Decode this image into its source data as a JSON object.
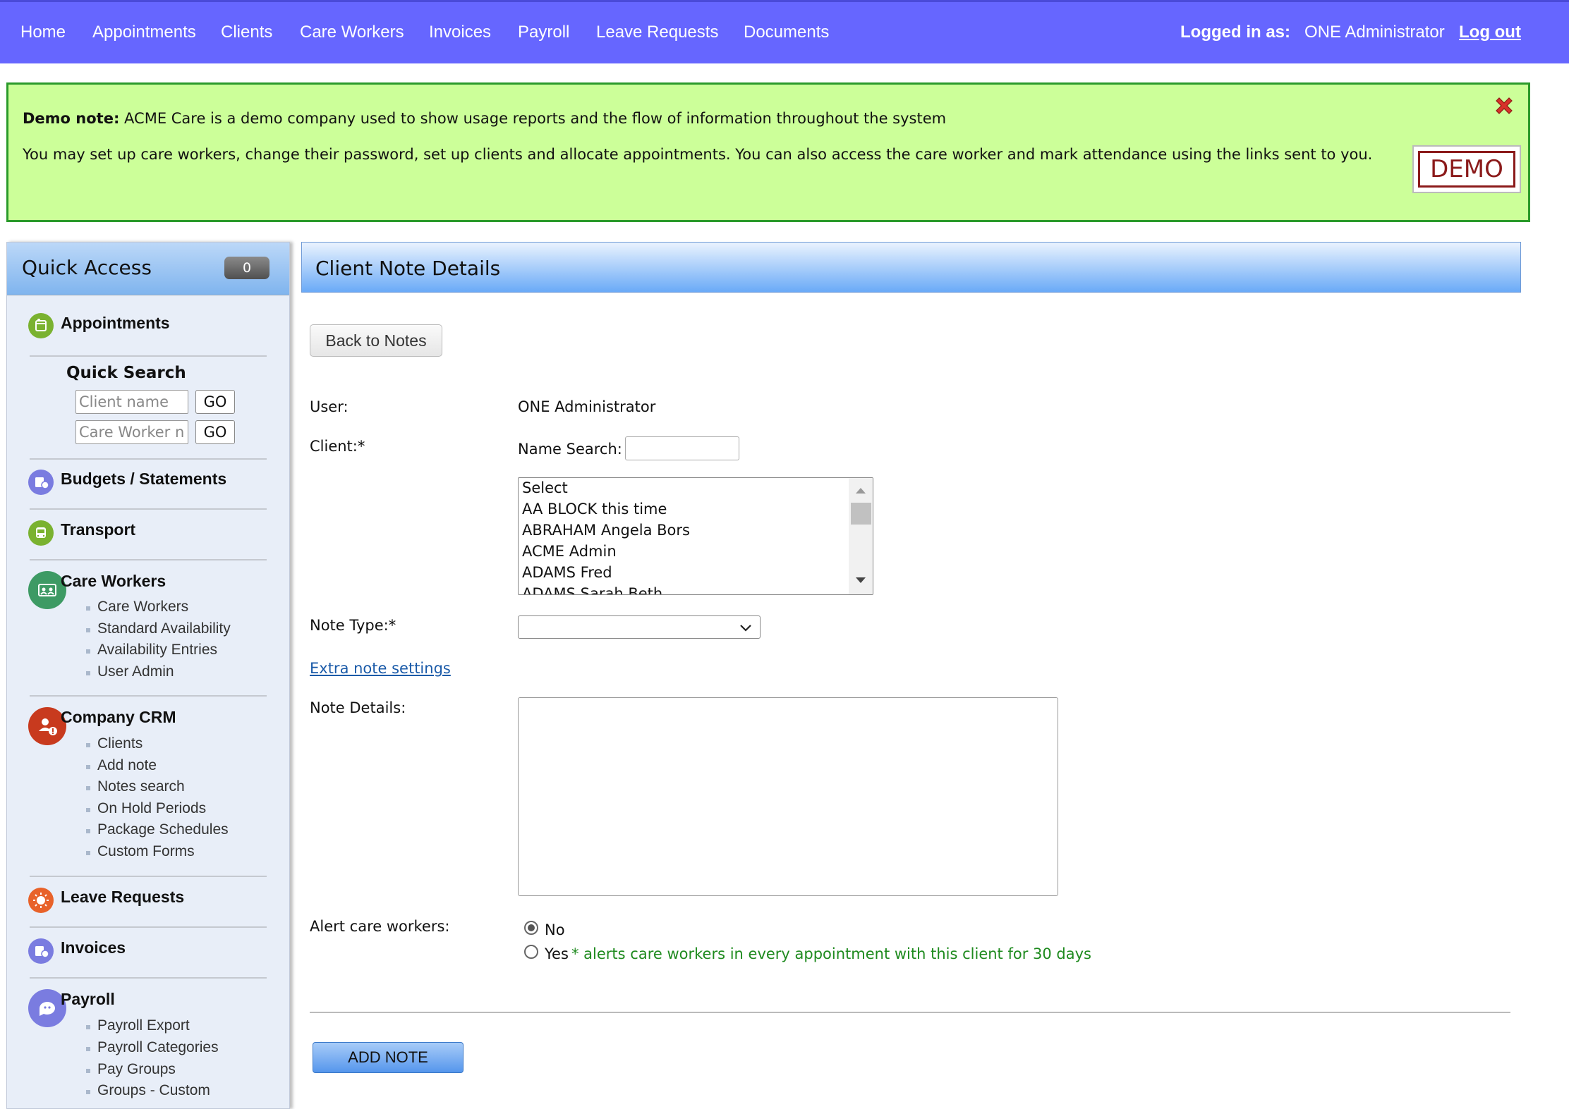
{
  "nav": {
    "items": [
      "Home",
      "Appointments",
      "Clients",
      "Care Workers",
      "Invoices",
      "Payroll",
      "Leave Requests",
      "Documents"
    ],
    "logged_in_label": "Logged in as:",
    "user": "ONE Administrator",
    "logout": "Log out",
    "bg_color": "#6666ff"
  },
  "demo": {
    "bold": "Demo note:",
    "text1": " ACME Care is a demo company used to show usage reports and the flow of information throughout the system",
    "text2": "You may set up care workers, change their password, set up clients and allocate appointments. You can also access the care worker and mark attendance using the links sent to you.",
    "badge": "DEMO",
    "bg_color": "#ccff99"
  },
  "sidebar": {
    "title": "Quick Access",
    "count": "0",
    "appointments": "Appointments",
    "quick_search": {
      "title": "Quick Search",
      "client_placeholder": "Client name",
      "worker_placeholder": "Care Worker name",
      "go": "GO"
    },
    "budgets": "Budgets / Statements",
    "transport": "Transport",
    "care_workers": {
      "title": "Care Workers",
      "links": [
        "Care Workers",
        "Standard Availability",
        "Availability Entries",
        "User Admin"
      ]
    },
    "crm": {
      "title": "Company CRM",
      "links": [
        "Clients",
        "Add note",
        "Notes search",
        "On Hold Periods",
        "Package Schedules",
        "Custom Forms"
      ]
    },
    "leave": "Leave Requests",
    "invoices": "Invoices",
    "payroll": {
      "title": "Payroll",
      "links": [
        "Payroll Export",
        "Payroll Categories",
        "Pay Groups",
        "Groups - Custom"
      ]
    }
  },
  "main": {
    "title": "Client Note Details",
    "back_button": "Back to Notes",
    "user_label": "User:",
    "user_value": "ONE Administrator",
    "client_label": "Client:*",
    "name_search_label": "Name Search:",
    "name_search_value": "",
    "client_options": [
      "Select",
      "AA BLOCK this time",
      "ABRAHAM Angela Bors",
      "ACME Admin",
      "ADAMS Fred",
      "ADAMS Sarah Beth"
    ],
    "note_type_label": "Note Type:*",
    "note_type_value": "",
    "extra_settings": "Extra note settings",
    "note_details_label": "Note Details:",
    "note_details_value": "",
    "alert_label": "Alert care workers:",
    "alert_selected": "No",
    "alert_no": "No",
    "alert_yes": "Yes",
    "alert_note": "* alerts care workers in every appointment with this client for 30 days",
    "add_button": "ADD NOTE"
  }
}
